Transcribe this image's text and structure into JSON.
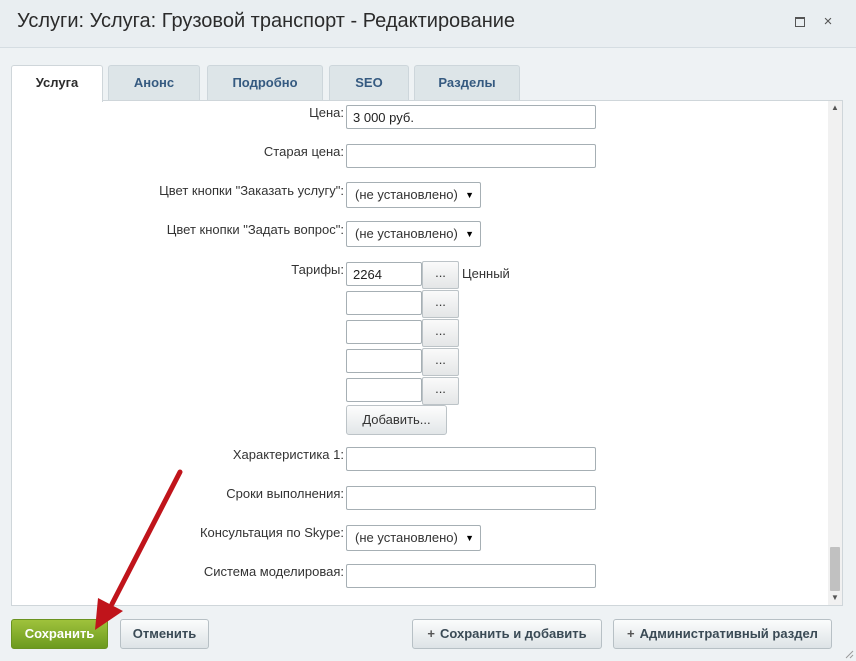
{
  "window": {
    "title": "Услуги: Услуга: Грузовой транспорт - Редактирование",
    "maximize_icon": "maximize-icon",
    "close_glyph": "×"
  },
  "tabs": [
    {
      "label": "Услуга",
      "active": true
    },
    {
      "label": "Анонс",
      "active": false
    },
    {
      "label": "Подробно",
      "active": false
    },
    {
      "label": "SEO",
      "active": false
    },
    {
      "label": "Разделы",
      "active": false
    }
  ],
  "form": {
    "price": {
      "label": "Цена:",
      "value": "3 000 руб."
    },
    "old_price": {
      "label": "Старая цена:",
      "value": ""
    },
    "order_btn_color": {
      "label": "Цвет кнопки \"Заказать услугу\":",
      "value": "(не установлено)"
    },
    "question_btn_color": {
      "label": "Цвет кнопки \"Задать вопрос\":",
      "value": "(не установлено)"
    },
    "tariffs": {
      "label": "Тарифы:",
      "rows": [
        {
          "value": "2264",
          "name": "Ценный"
        },
        {
          "value": "",
          "name": ""
        },
        {
          "value": "",
          "name": ""
        },
        {
          "value": "",
          "name": ""
        },
        {
          "value": "",
          "name": ""
        }
      ],
      "browse_label": "...",
      "add_label": "Добавить..."
    },
    "characteristic1": {
      "label": "Характеристика 1:",
      "value": ""
    },
    "deadlines": {
      "label": "Сроки выполнения:",
      "value": ""
    },
    "skype": {
      "label": "Консультация по Skype:",
      "value": "(не установлено)"
    },
    "modeling": {
      "label": "Система моделировая:",
      "value": ""
    }
  },
  "buttons": {
    "save": "Сохранить",
    "cancel": "Отменить",
    "save_add": "Сохранить и добавить",
    "admin_section": "Административный раздел"
  },
  "colors": {
    "save_button": "#7ea82a",
    "annotation_arrow": "#c0141b",
    "tab_text": "#355a80"
  }
}
